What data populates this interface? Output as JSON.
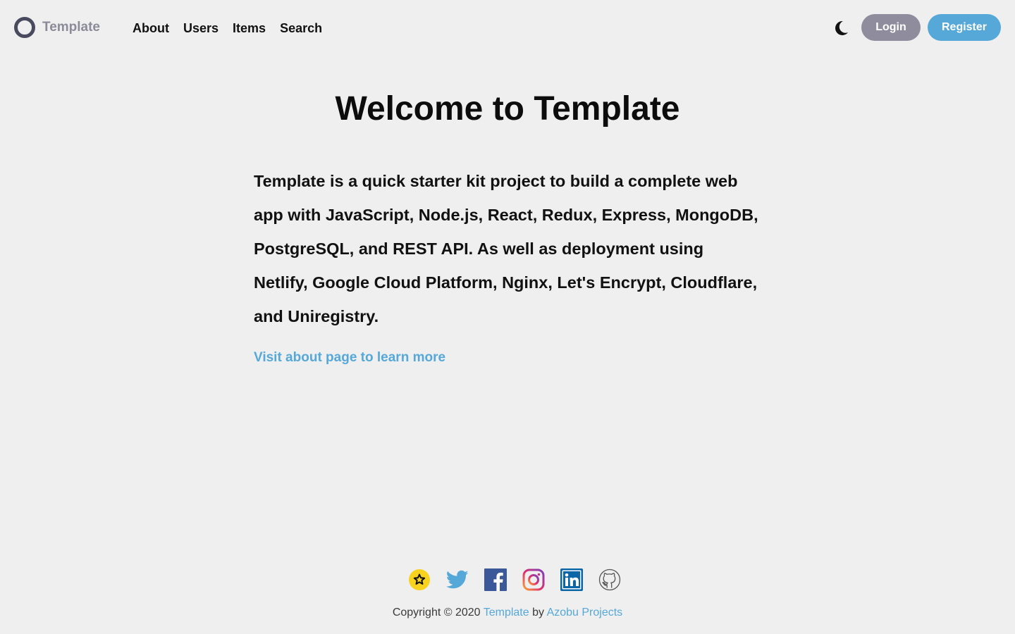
{
  "header": {
    "brand_name": "Template",
    "nav": [
      "About",
      "Users",
      "Items",
      "Search"
    ],
    "theme_icon": "moon-icon",
    "login_label": "Login",
    "register_label": "Register"
  },
  "main": {
    "title": "Welcome to Template",
    "intro": "Template is a quick starter kit project to build a complete web app with JavaScript, Node.js, React, Redux, Express, MongoDB, PostgreSQL, and REST API. As well as deployment using Netlify, Google Cloud Platform, Nginx, Let's Encrypt, Cloudflare, and Uniregistry.",
    "about_link": "Visit about page to learn more"
  },
  "footer": {
    "socials": [
      "star-icon",
      "twitter-icon",
      "facebook-icon",
      "instagram-icon",
      "linkedin-icon",
      "github-icon"
    ],
    "copyright_prefix": "Copyright © 2020",
    "brand_link": "Template",
    "by": "by",
    "author_link": "Azobu Projects"
  },
  "colors": {
    "background": "#efefef",
    "accent": "#55a8d8",
    "login_button": "#8f8c9e",
    "brand_ring": "#4a4a5e"
  }
}
